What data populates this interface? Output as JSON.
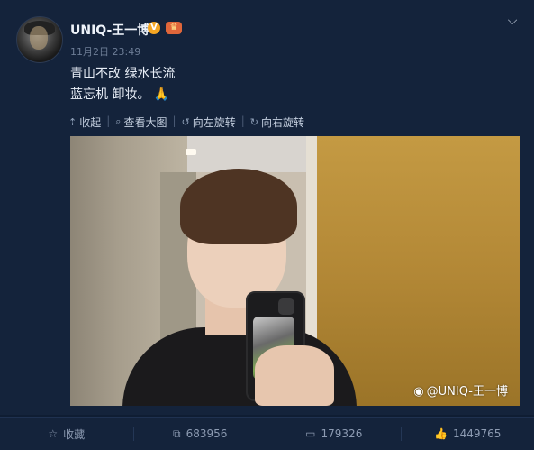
{
  "post": {
    "username": "UNIQ-王一博",
    "verified_badge": "V",
    "time": "11月2日 23:49",
    "text_line1": "青山不改 绿水长流",
    "text_line2": "蓝忘机 卸妆。",
    "emoji_icon": "folded-hands-icon"
  },
  "actions": [
    {
      "icon": "collapse-up-icon",
      "label": "收起"
    },
    {
      "icon": "zoom-icon",
      "label": "查看大图"
    },
    {
      "icon": "rotate-left-icon",
      "label": "向左旋转"
    },
    {
      "icon": "rotate-right-icon",
      "label": "向右旋转"
    }
  ],
  "photo": {
    "watermark": "@UNIQ-王一博"
  },
  "bottom": {
    "favorite_label": "收藏",
    "repost_count": "683956",
    "comment_count": "179326",
    "like_count": "1449765"
  },
  "colors": {
    "background": "#14233b",
    "accent": "#f5a623"
  }
}
